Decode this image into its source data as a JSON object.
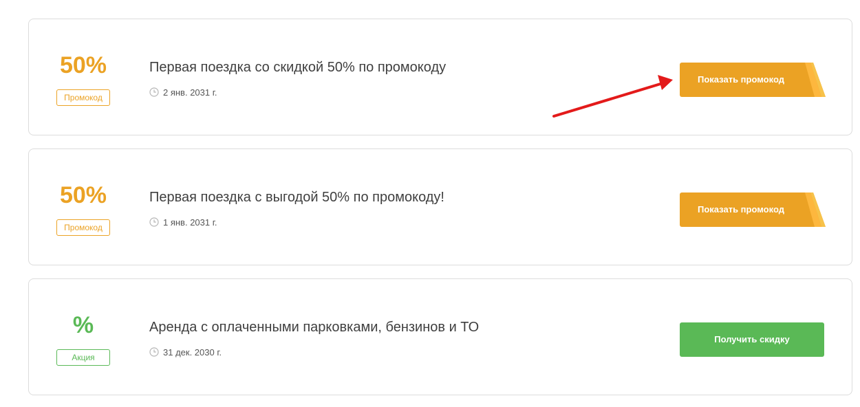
{
  "colors": {
    "promo": "#eba224",
    "deal": "#5ab956",
    "arrow": "#e31a1a"
  },
  "cards": [
    {
      "value": "50%",
      "badge": "Промокод",
      "title": "Первая поездка со скидкой 50% по промокоду",
      "date": "2 янв. 2031 г.",
      "button": "Показать промокод",
      "type": "promo"
    },
    {
      "value": "50%",
      "badge": "Промокод",
      "title": "Первая поездка с выгодой 50% по промокоду!",
      "date": "1 янв. 2031 г.",
      "button": "Показать промокод",
      "type": "promo"
    },
    {
      "value": "%",
      "badge": "Акция",
      "title": "Аренда с оплаченными парковками, бензинов и ТО",
      "date": "31 дек. 2030 г.",
      "button": "Получить скидку",
      "type": "deal"
    }
  ],
  "icons": {
    "date": "clock-icon",
    "annotation": "red-arrow"
  }
}
